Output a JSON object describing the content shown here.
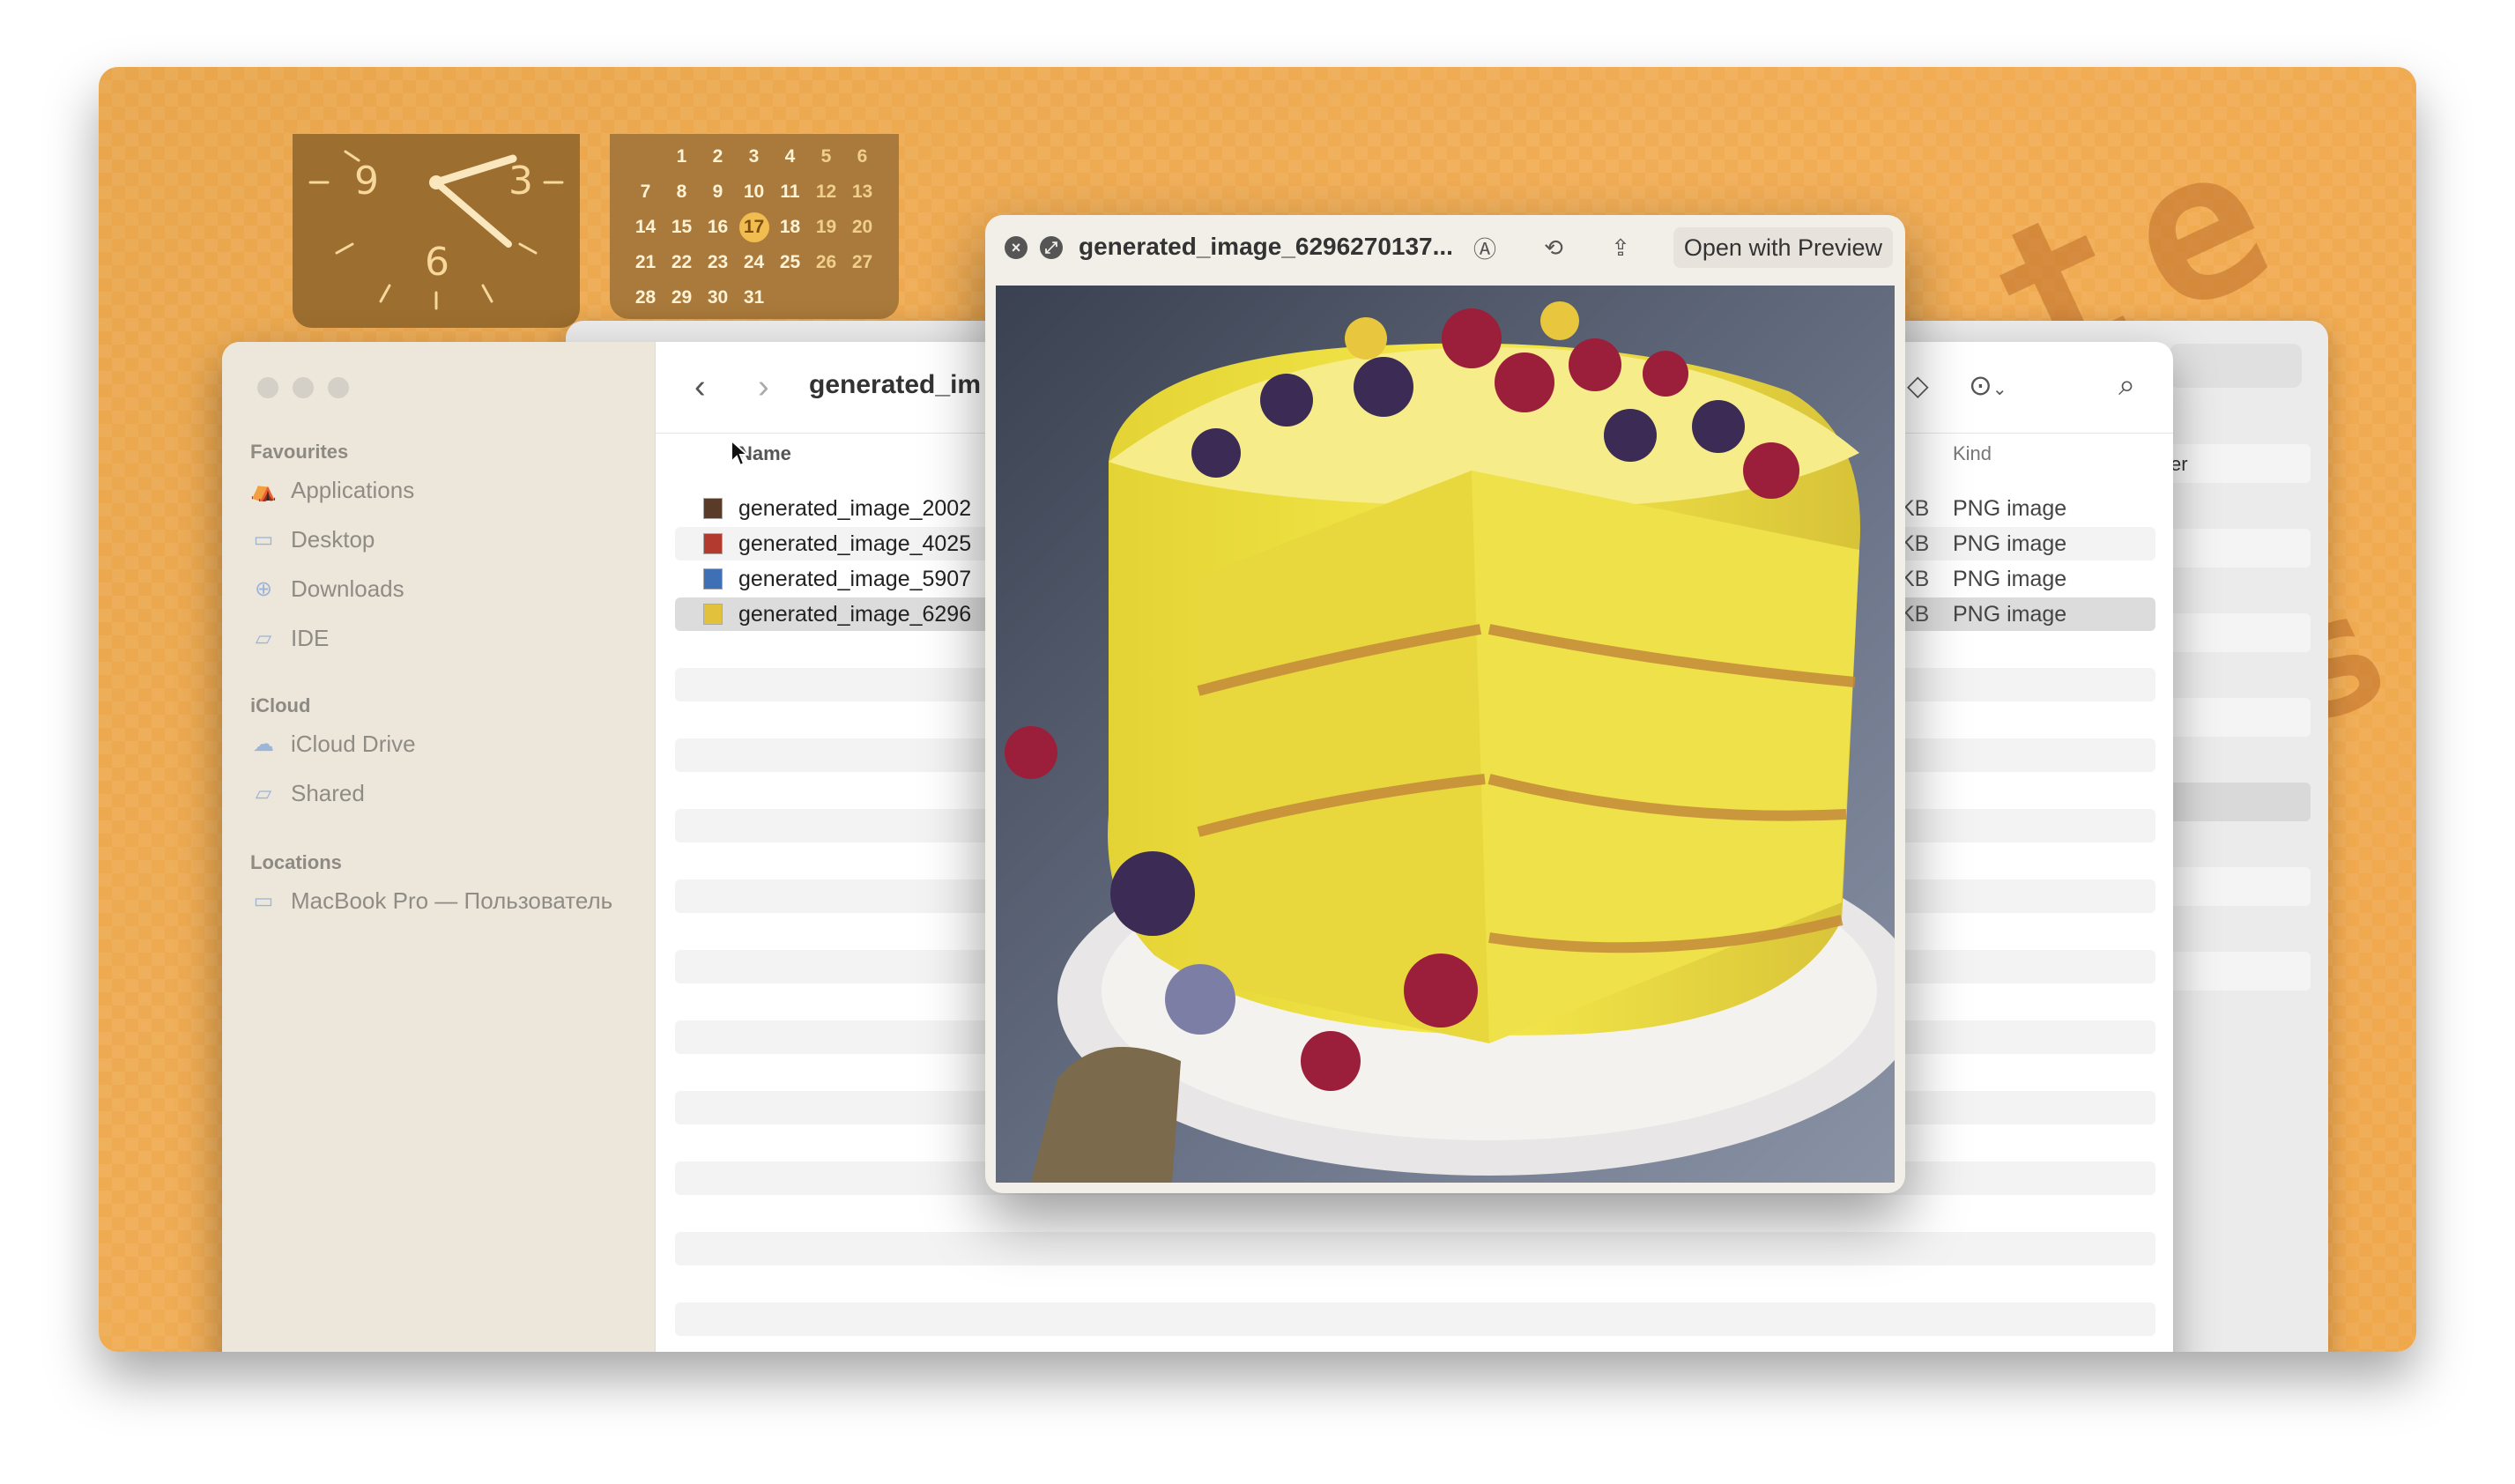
{
  "widgets": {
    "clock": {
      "numerals": [
        "9",
        "3",
        "6"
      ]
    },
    "calendar": {
      "weeks": [
        [
          "",
          "1",
          "2",
          "3",
          "4",
          "5",
          "6"
        ],
        [
          "7",
          "8",
          "9",
          "10",
          "11",
          "12",
          "13"
        ],
        [
          "14",
          "15",
          "16",
          "17",
          "18",
          "19",
          "20"
        ],
        [
          "21",
          "22",
          "23",
          "24",
          "25",
          "26",
          "27"
        ],
        [
          "28",
          "29",
          "30",
          "31",
          "",
          "",
          ""
        ]
      ],
      "today": "17"
    }
  },
  "finder": {
    "folder_title": "generated_im",
    "sidebar": {
      "favourites_label": "Favourites",
      "favourites": [
        {
          "label": "Applications",
          "icon": "applications-icon"
        },
        {
          "label": "Desktop",
          "icon": "desktop-icon"
        },
        {
          "label": "Downloads",
          "icon": "downloads-icon"
        },
        {
          "label": "IDE",
          "icon": "folder-icon"
        }
      ],
      "icloud_label": "iCloud",
      "icloud": [
        {
          "label": "iCloud Drive",
          "icon": "cloud-icon"
        },
        {
          "label": "Shared",
          "icon": "shared-folder-icon"
        }
      ],
      "locations_label": "Locations",
      "locations": [
        {
          "label": "MacBook Pro — Пользователь",
          "icon": "laptop-icon"
        }
      ]
    },
    "columns": {
      "name": "Name",
      "kind": "Kind"
    },
    "files": [
      {
        "name": "generated_image_2002",
        "size": "KB",
        "kind": "PNG image",
        "thumb_color": "#5a3b2a"
      },
      {
        "name": "generated_image_4025",
        "size": "KB",
        "kind": "PNG image",
        "thumb_color": "#b33a2e"
      },
      {
        "name": "generated_image_5907",
        "size": "KB",
        "kind": "PNG image",
        "thumb_color": "#3f6fb5"
      },
      {
        "name": "generated_image_6296",
        "size": "KB",
        "kind": "PNG image",
        "thumb_color": "#e2c23c"
      }
    ],
    "selected_file_index": 3
  },
  "back_window": {
    "row_text": "ver"
  },
  "quicklook": {
    "title": "generated_image_6296270137...",
    "open_button": "Open with Preview",
    "icons": [
      "close-icon",
      "fullscreen-icon",
      "markup-icon",
      "rotate-icon",
      "share-icon"
    ]
  },
  "colors": {
    "wallpaper": "#f0a84d",
    "selection": "#dcdcdc",
    "cake_yellow": "#f1e34a"
  }
}
